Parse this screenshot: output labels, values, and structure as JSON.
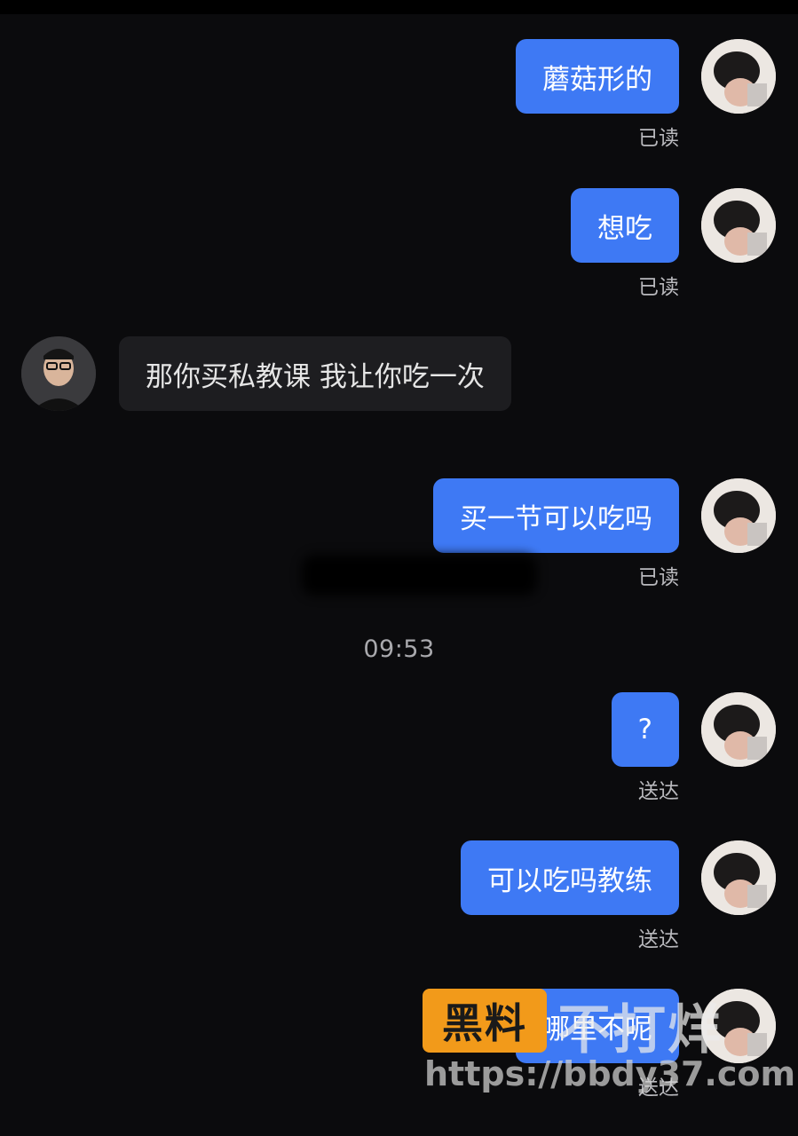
{
  "chat": {
    "messages": [
      {
        "text": "蘑菇形的",
        "status": "已读"
      },
      {
        "text": "想吃",
        "status": "已读"
      },
      {
        "text": "那你买私教课 我让你吃一次"
      },
      {
        "text": "买一节可以吃吗",
        "status": "已读"
      },
      {
        "text": "?",
        "status": "送达"
      },
      {
        "text": "可以吃吗教练",
        "status": "送达"
      },
      {
        "text": "哪里不呢",
        "status": "送达"
      }
    ],
    "time_separator": "09:53"
  },
  "watermark": {
    "badge": "黑料",
    "text": "不打烊",
    "url": "https://bbdy37.com"
  },
  "colors": {
    "background": "#0b0b0d",
    "my_bubble": "#3e79f4",
    "other_bubble": "#1d1d20",
    "watermark_badge": "#f29a1a"
  },
  "icons": {
    "my_avatar": "user-avatar-photo",
    "other_avatar": "coach-avatar-photo"
  }
}
